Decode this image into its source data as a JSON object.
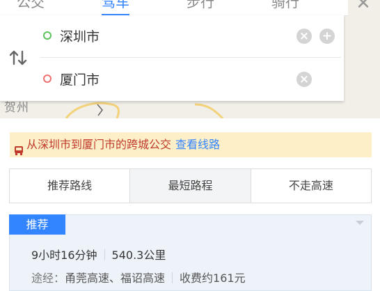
{
  "top_tabs": [
    {
      "label": "公交",
      "active": false
    },
    {
      "label": "驾车",
      "active": true
    },
    {
      "label": "步行",
      "active": false
    },
    {
      "label": "骑行",
      "active": false
    }
  ],
  "route": {
    "from": "深圳市",
    "to": "厦门市"
  },
  "map": {
    "place_label": "贺州"
  },
  "notice": {
    "text": "从深圳市到厦门市的跨城公交",
    "link": "查看线路"
  },
  "strategy": {
    "options": [
      "推荐路线",
      "最短路程",
      "不走高速"
    ],
    "selected_index": 1
  },
  "result": {
    "badge": "推荐",
    "duration": "9小时16分钟",
    "distance": "540.3公里",
    "via_label": "途经：",
    "via": "甬莞高速、福诏高速",
    "toll": "收费约161元"
  },
  "colors": {
    "accent": "#3385ff",
    "notice_bg": "#fdf0c8",
    "notice_text": "#c0392b",
    "start_dot": "#5cc25c",
    "end_dot": "#f07070"
  }
}
